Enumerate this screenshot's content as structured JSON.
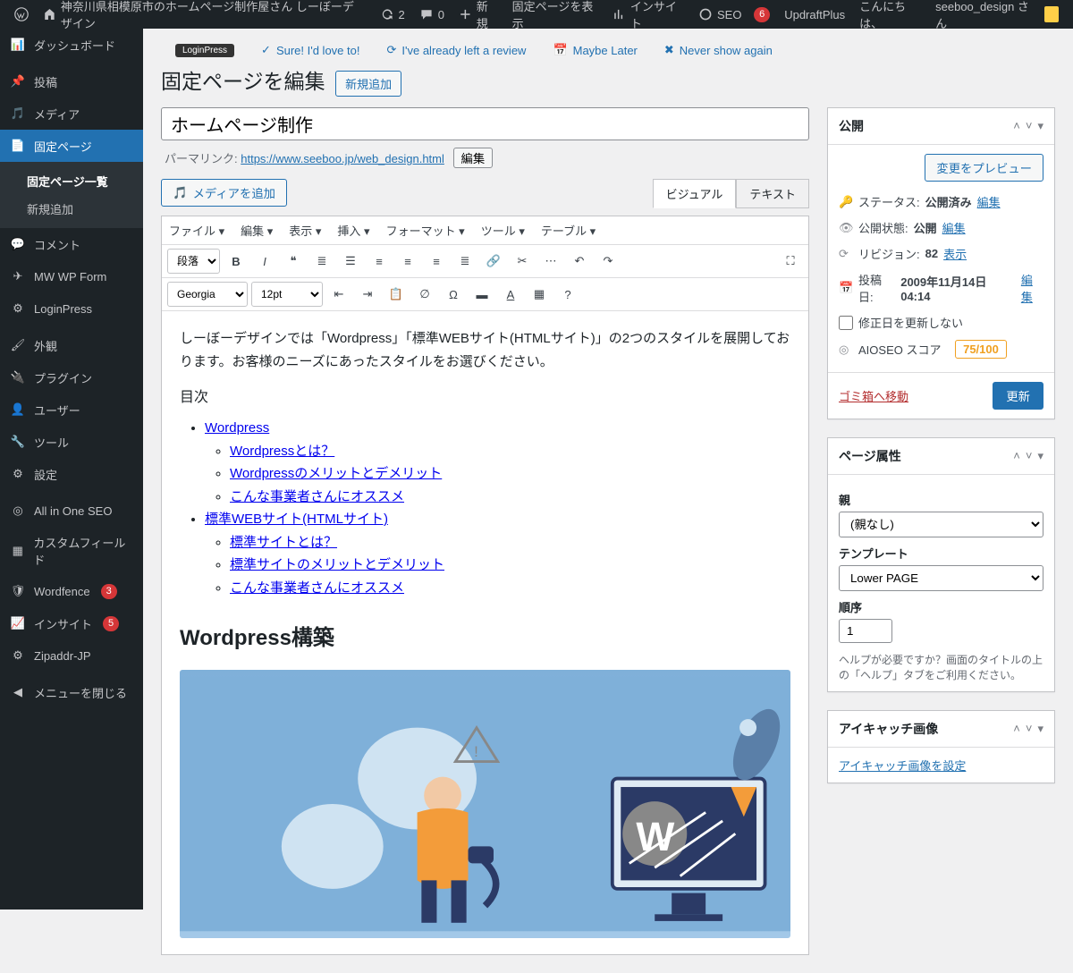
{
  "adminbar": {
    "site_name": "神奈川県相模原市のホームページ制作屋さん しーぼーデザイン",
    "updates_count": "2",
    "comments_count": "0",
    "new": "新規",
    "view_page": "固定ページを表示",
    "insights": "インサイト",
    "seo": "SEO",
    "seo_badge": "6",
    "updraft": "UpdraftPlus",
    "greeting": "こんにちは、",
    "user": "seeboo_design さん"
  },
  "sidebar": {
    "items": [
      {
        "label": "ダッシュボード",
        "icon": "dashboard-icon"
      },
      {
        "label": "投稿",
        "icon": "pin-icon"
      },
      {
        "label": "メディア",
        "icon": "media-icon"
      },
      {
        "label": "固定ページ",
        "icon": "page-icon",
        "current": true,
        "sub": [
          {
            "label": "固定ページ一覧",
            "current": true
          },
          {
            "label": "新規追加"
          }
        ]
      },
      {
        "label": "コメント",
        "icon": "comment-icon"
      },
      {
        "label": "MW WP Form",
        "icon": "form-icon"
      },
      {
        "label": "LoginPress",
        "icon": "login-icon"
      },
      {
        "label": "外観",
        "icon": "appearance-icon"
      },
      {
        "label": "プラグイン",
        "icon": "plugin-icon"
      },
      {
        "label": "ユーザー",
        "icon": "user-icon"
      },
      {
        "label": "ツール",
        "icon": "tool-icon"
      },
      {
        "label": "設定",
        "icon": "settings-icon"
      },
      {
        "label": "All in One SEO",
        "icon": "aioseo-icon"
      },
      {
        "label": "カスタムフィールド",
        "icon": "customfield-icon"
      },
      {
        "label": "Wordfence",
        "icon": "wordfence-icon",
        "badge": "3"
      },
      {
        "label": "インサイト",
        "icon": "insight-icon",
        "badge": "5"
      },
      {
        "label": "Zipaddr-JP",
        "icon": "zip-icon"
      },
      {
        "label": "メニューを閉じる",
        "icon": "collapse-icon"
      }
    ]
  },
  "notice": {
    "lp": "LoginPress",
    "love": "Sure! I'd love to!",
    "already": "I've already left a review",
    "later": "Maybe Later",
    "never": "Never show again"
  },
  "header": {
    "title": "固定ページを編集",
    "add_new": "新規追加"
  },
  "title_field": {
    "value": "ホームページ制作"
  },
  "permalink": {
    "label": "パーマリンク:",
    "url": "https://www.seeboo.jp/web_design.html",
    "edit": "編集"
  },
  "media_btn": "メディアを追加",
  "tabs": {
    "visual": "ビジュアル",
    "text": "テキスト"
  },
  "menubar": {
    "file": "ファイル ▾",
    "edit": "編集 ▾",
    "view": "表示 ▾",
    "insert": "挿入 ▾",
    "format": "フォーマット ▾",
    "tools": "ツール ▾",
    "table": "テーブル ▾"
  },
  "toolbar1": {
    "style": "段落"
  },
  "toolbar2": {
    "font": "Georgia",
    "size": "12pt"
  },
  "content": {
    "intro": "しーぼーデザインでは「Wordpress」「標準WEBサイト(HTMLサイト)」の2つのスタイルを展開しております。お客様のニーズにあったスタイルをお選びください。",
    "toc_title": "目次",
    "toc": {
      "wp": "Wordpress",
      "wp1": "Wordpressとは？",
      "wp2": "Wordpressのメリットとデメリット",
      "wp3": "こんな事業者さんにオススメ",
      "html": "標準WEBサイト(HTMLサイト)",
      "html1": "標準サイトとは？",
      "html2": "標準サイトのメリットとデメリット",
      "html3": "こんな事業者さんにオススメ"
    },
    "h2_wp": "Wordpress構築"
  },
  "publish": {
    "title": "公開",
    "preview_btn": "変更をプレビュー",
    "status_label": "ステータス:",
    "status_value": "公開済み",
    "edit": "編集",
    "visibility_label": "公開状態:",
    "visibility_value": "公開",
    "revisions_label": "リビジョン:",
    "revisions_value": "82",
    "browse": "表示",
    "date_label": "投稿日:",
    "date_value": "2009年11月14日 04:14",
    "nodate_update": "修正日を更新しない",
    "aioseo_label": "AIOSEO スコア",
    "aioseo_score": "75/100",
    "trash": "ゴミ箱へ移動",
    "update": "更新"
  },
  "attrs": {
    "title": "ページ属性",
    "parent_label": "親",
    "parent_value": "(親なし)",
    "template_label": "テンプレート",
    "template_value": "Lower PAGE",
    "order_label": "順序",
    "order_value": "1",
    "help": "ヘルプが必要ですか？画面のタイトルの上の「ヘルプ」タブをご利用ください。"
  },
  "featured": {
    "title": "アイキャッチ画像",
    "set": "アイキャッチ画像を設定"
  }
}
